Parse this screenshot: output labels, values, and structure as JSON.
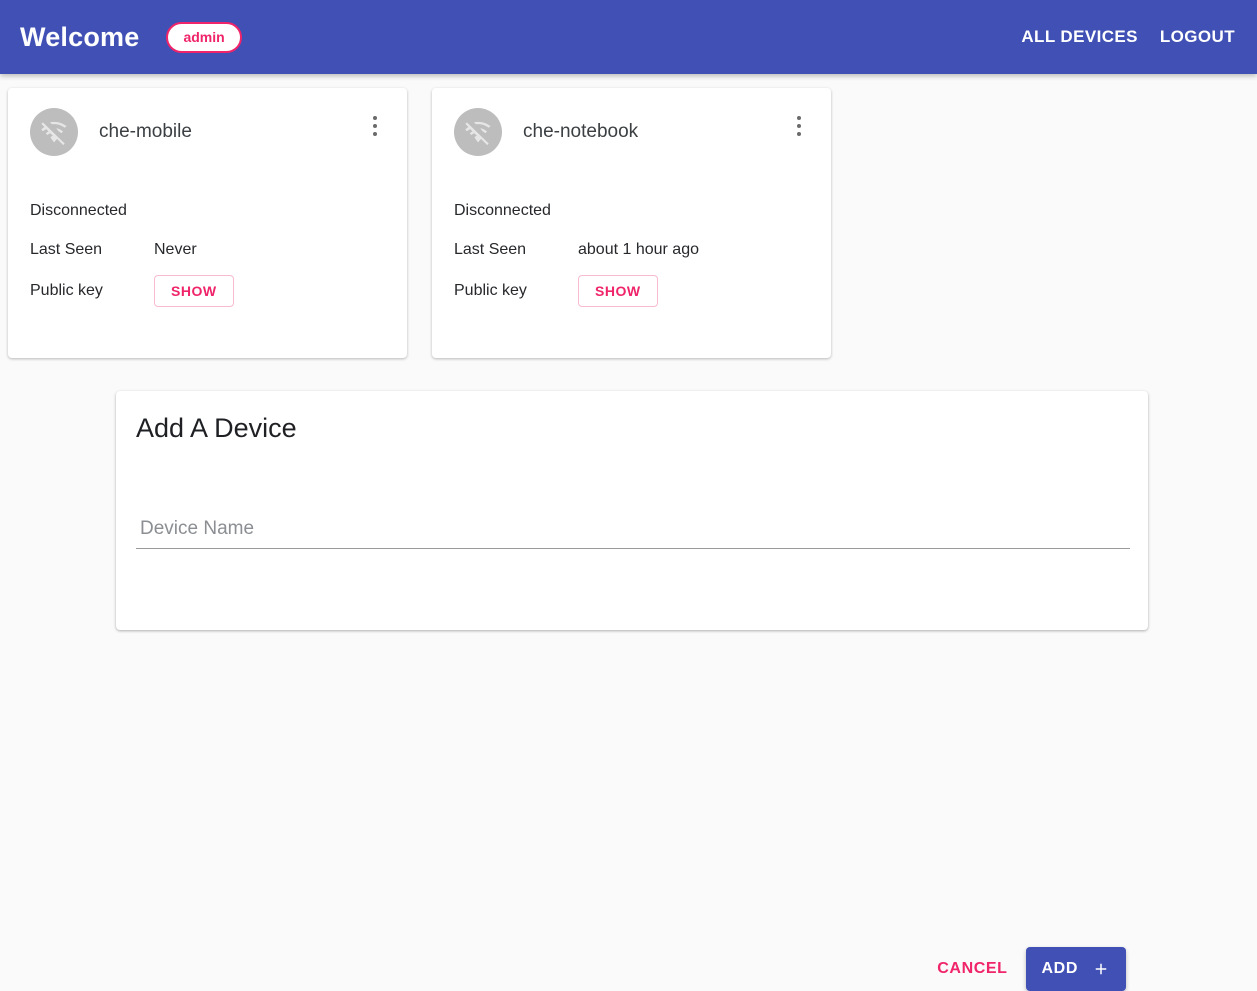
{
  "header": {
    "welcome_label": "Welcome",
    "user_badge": "admin",
    "nav": [
      {
        "label": "ALL DEVICES",
        "name": "all-devices"
      },
      {
        "label": "LOGOUT",
        "name": "logout"
      }
    ]
  },
  "devices": [
    {
      "name": "che-mobile",
      "status": "Disconnected",
      "status_icon": "wifi-off-icon",
      "last_seen_label": "Last Seen",
      "last_seen_value": "Never",
      "public_key_label": "Public key",
      "show_button": "SHOW"
    },
    {
      "name": "che-notebook",
      "status": "Disconnected",
      "status_icon": "wifi-off-icon",
      "last_seen_label": "Last Seen",
      "last_seen_value": "about 1 hour ago",
      "public_key_label": "Public key",
      "show_button": "SHOW"
    }
  ],
  "add_device": {
    "title": "Add A Device",
    "input_placeholder": "Device Name",
    "input_value": "",
    "cancel_label": "CANCEL",
    "add_label": "ADD"
  },
  "colors": {
    "primary": "#4050b5",
    "accent_pink": "#f0246a",
    "page_background": "#fafafa",
    "card_background": "#ffffff",
    "avatar_background": "#bdbdbd",
    "text_primary": "#26282b"
  }
}
